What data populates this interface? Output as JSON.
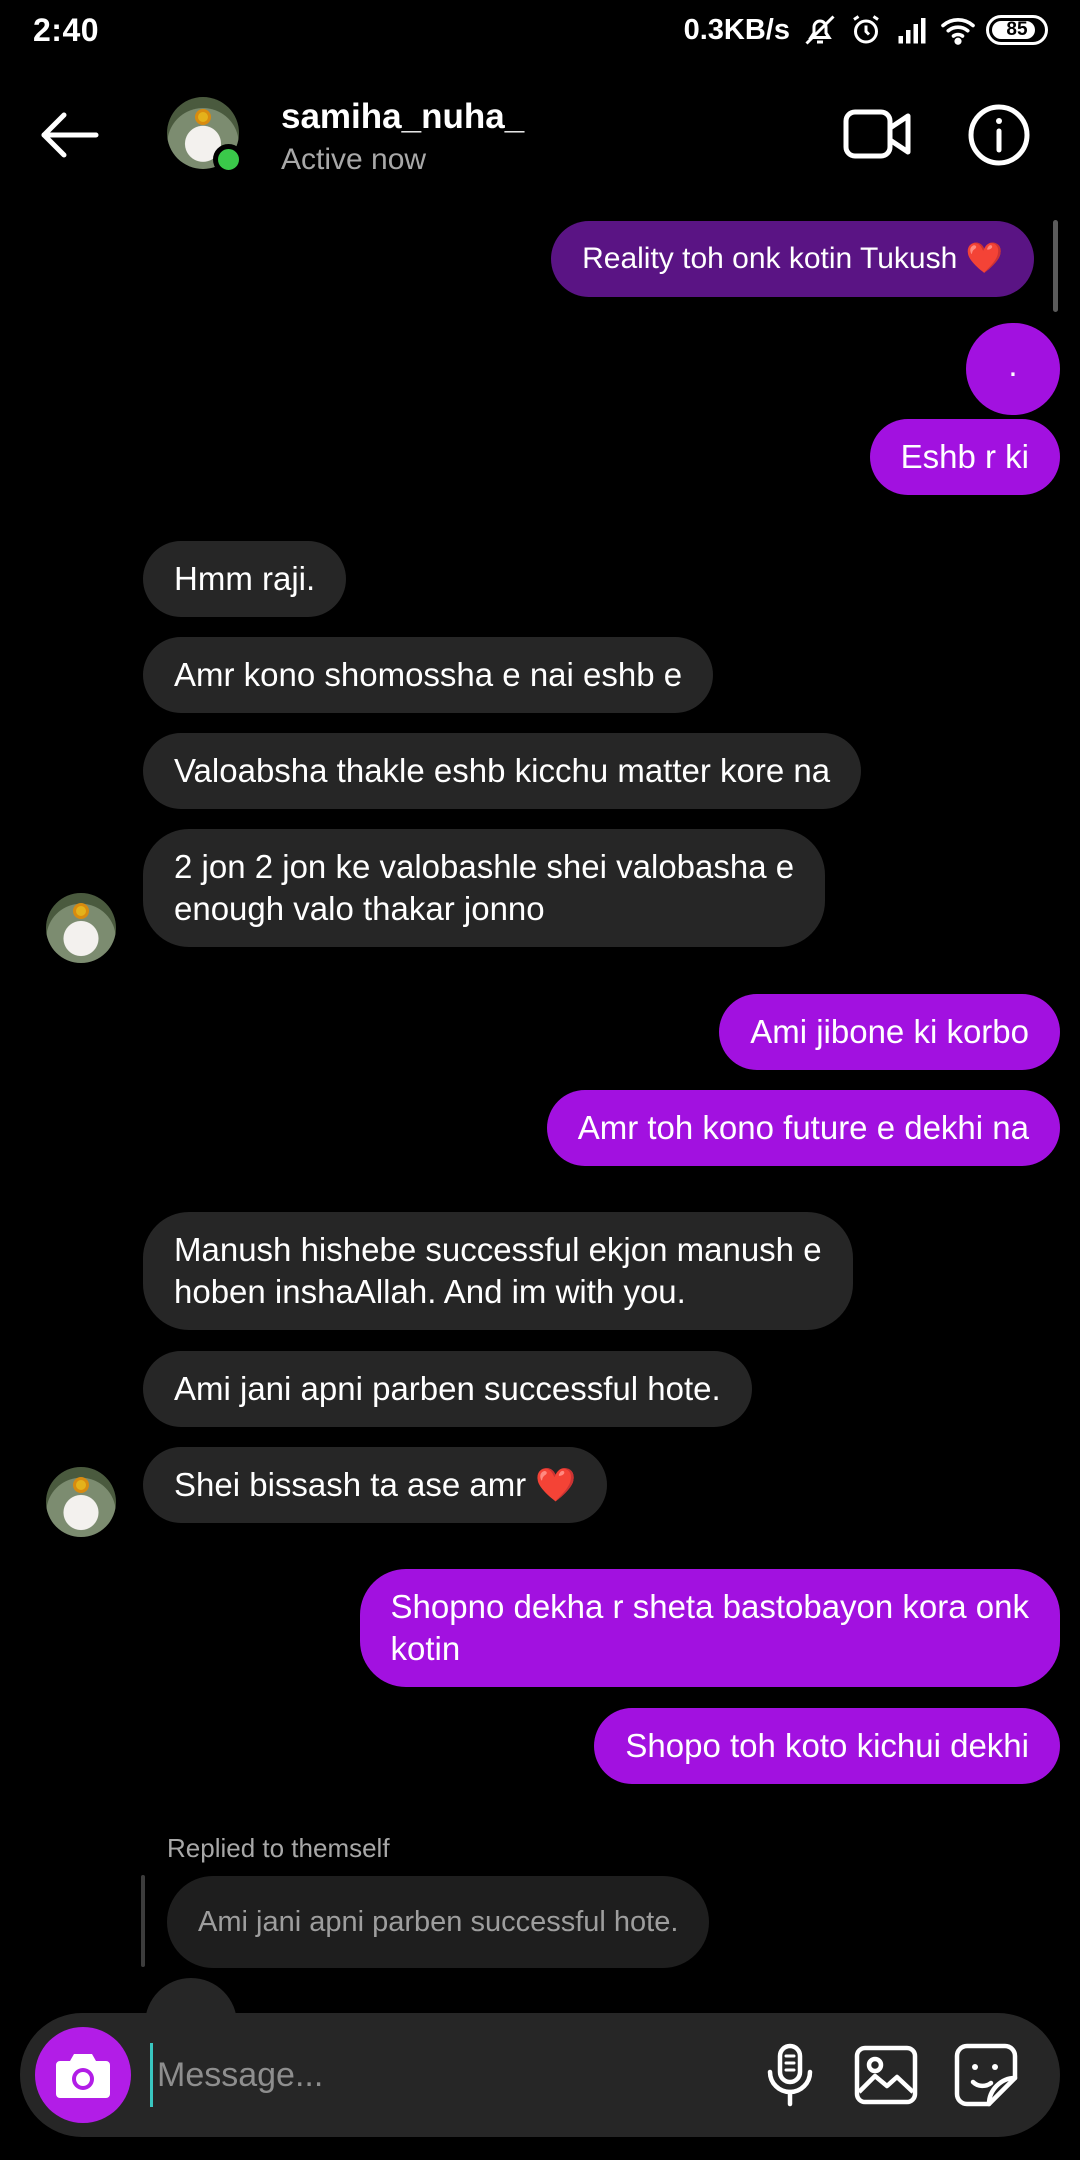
{
  "status_bar": {
    "time": "2:40",
    "net_speed": "0.3KB/s",
    "battery": "85",
    "battery_level": 0.85,
    "icons": [
      "mute-icon",
      "alarm-icon",
      "signal-icon",
      "wifi-icon",
      "battery-icon"
    ]
  },
  "header": {
    "name": "samiha_nuha_",
    "status": "Active now",
    "icons": [
      "back-arrow-icon",
      "video-call-icon",
      "info-icon"
    ]
  },
  "messages": [
    {
      "text": "Reality toh onk kotin Tukush ❤️",
      "sender": "me"
    },
    {
      "text": ".",
      "sender": "me"
    },
    {
      "text": "Eshb r ki",
      "sender": "me"
    },
    {
      "text": "Hmm raji.",
      "sender": "them"
    },
    {
      "text": "Amr kono shomossha e nai eshb e",
      "sender": "them"
    },
    {
      "text": "Valoabsha thakle eshb kicchu matter kore na",
      "sender": "them"
    },
    {
      "line1": "2 jon 2 jon ke valobashle shei valobasha e",
      "line2": "enough valo thakar jonno",
      "sender": "them"
    },
    {
      "text": "Ami jibone ki korbo",
      "sender": "me"
    },
    {
      "text": "Amr toh kono future e dekhi na",
      "sender": "me"
    },
    {
      "line1": "Manush hishebe successful ekjon manush e",
      "line2": "hoben inshaAllah. And im with you.",
      "sender": "them"
    },
    {
      "text": "Ami jani apni parben successful hote.",
      "sender": "them"
    },
    {
      "text": "Shei bissash ta ase amr",
      "heart": "❤️",
      "sender": "them"
    },
    {
      "line1": "Shopno dekha r sheta bastobayon kora onk",
      "line2": "kotin",
      "sender": "me"
    },
    {
      "text": "Shopo toh koto kichui dekhi",
      "sender": "me"
    }
  ],
  "reply": {
    "label": "Replied to themself",
    "quoted": "Ami jani apni parben successful hote."
  },
  "composer": {
    "placeholder": "Message...",
    "icons": [
      "camera-icon",
      "microphone-icon",
      "gallery-icon",
      "sticker-icon"
    ]
  },
  "colors": {
    "background": "#000000",
    "outgoing_bubble": "#a211e0",
    "outgoing_bubble_dark": "#5a1484",
    "incoming_bubble": "#262626",
    "online": "#3ac94a",
    "camera_button": "#b21de7"
  }
}
